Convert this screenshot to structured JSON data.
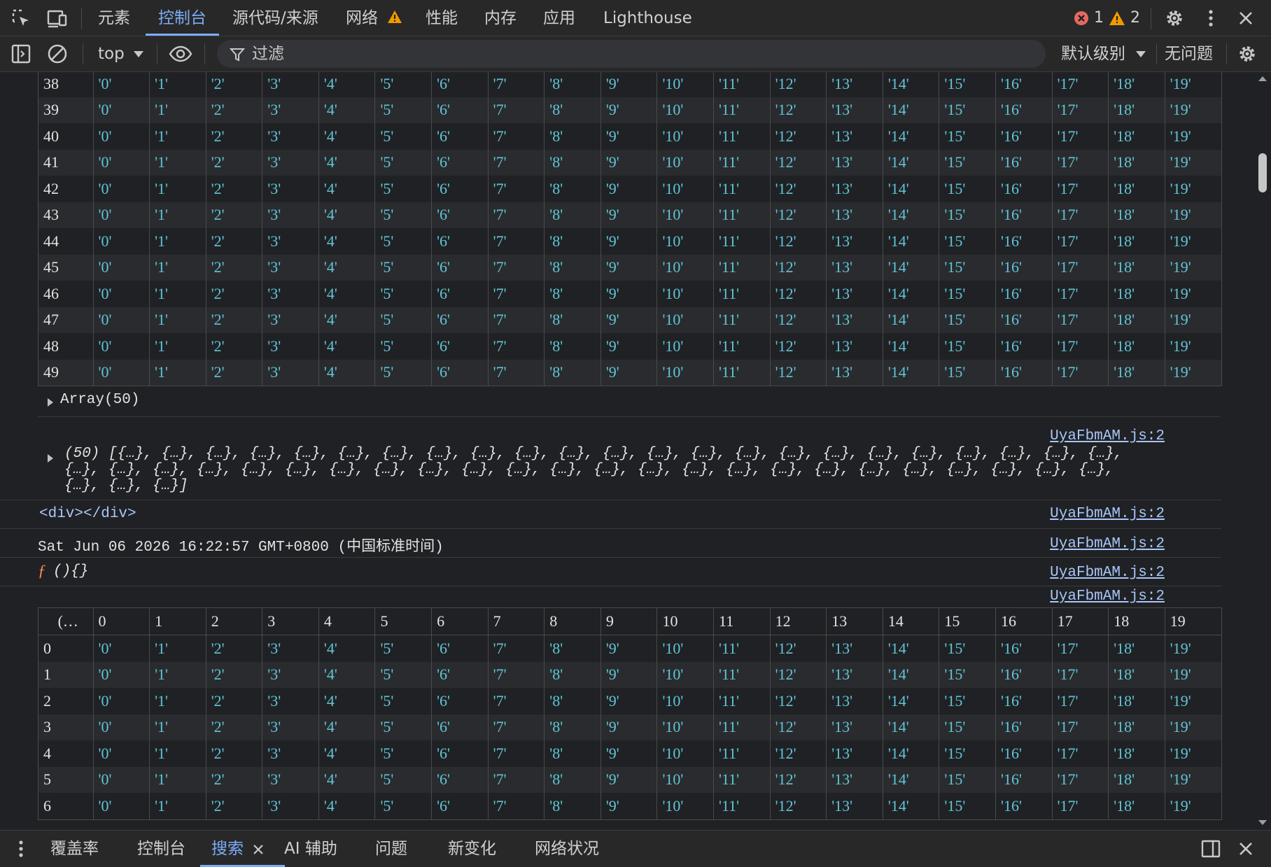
{
  "tabs": [
    {
      "label": "元素",
      "active": false
    },
    {
      "label": "控制台",
      "active": true
    },
    {
      "label": "源代码/来源",
      "active": false
    },
    {
      "label": "网络",
      "active": false,
      "warning": true
    },
    {
      "label": "性能",
      "active": false
    },
    {
      "label": "内存",
      "active": false
    },
    {
      "label": "应用",
      "active": false
    },
    {
      "label": "Lighthouse",
      "active": false
    }
  ],
  "counts": {
    "errors": "1",
    "warnings": "2"
  },
  "toolbar": {
    "context": "top",
    "filter_placeholder": "过滤",
    "levels": "默认级别",
    "issues": "无问题"
  },
  "table1": {
    "rows": [
      "38",
      "39",
      "40",
      "41",
      "42",
      "43",
      "44",
      "45",
      "46",
      "47",
      "48",
      "49"
    ],
    "values": [
      "'0'",
      "'1'",
      "'2'",
      "'3'",
      "'4'",
      "'5'",
      "'6'",
      "'7'",
      "'8'",
      "'9'",
      "'10'",
      "'11'",
      "'12'",
      "'13'",
      "'14'",
      "'15'",
      "'16'",
      "'17'",
      "'18'",
      "'19'"
    ]
  },
  "messages": {
    "array_label": "Array(50)",
    "array_source": "UyaFbmAM.js:2",
    "array_preview_line1": "(50)  [{…}, {…}, {…}, {…}, {…}, {…}, {…}, {…}, {…}, {…}, {…}, {…}, {…}, {…}, {…}, {…}, {…}, {…}, {…}, {…}, {…}, {…}, {…},",
    "array_preview_line2": "{…}, {…}, {…}, {…}, {…}, {…}, {…}, {…}, {…}, {…}, {…}, {…}, {…}, {…}, {…}, {…}, {…}, {…}, {…}, {…}, {…}, {…}, {…}, {…},",
    "array_preview_line3": "{…}, {…}, {…}]",
    "div_text": "<div></div>",
    "div_source": "UyaFbmAM.js:2",
    "date_text": "Sat Jun 06 2026 16:22:57 GMT+0800 (中国标准时间)",
    "date_source": "UyaFbmAM.js:2",
    "func_f": "ƒ",
    "func_text": " (){}",
    "func_source": "UyaFbmAM.js:2",
    "table2_source": "UyaFbmAM.js:2"
  },
  "table2": {
    "index_header": "(…",
    "headers": [
      "0",
      "1",
      "2",
      "3",
      "4",
      "5",
      "6",
      "7",
      "8",
      "9",
      "10",
      "11",
      "12",
      "13",
      "14",
      "15",
      "16",
      "17",
      "18",
      "19"
    ],
    "rows": [
      "0",
      "1",
      "2",
      "3",
      "4",
      "5",
      "6"
    ],
    "values": [
      "'0'",
      "'1'",
      "'2'",
      "'3'",
      "'4'",
      "'5'",
      "'6'",
      "'7'",
      "'8'",
      "'9'",
      "'10'",
      "'11'",
      "'12'",
      "'13'",
      "'14'",
      "'15'",
      "'16'",
      "'17'",
      "'18'",
      "'19'"
    ]
  },
  "drawer": {
    "tabs": [
      {
        "label": "覆盖率",
        "active": false
      },
      {
        "label": "控制台",
        "active": false
      },
      {
        "label": "搜索",
        "active": true,
        "closable": true
      },
      {
        "label": "AI 辅助",
        "active": false
      },
      {
        "label": "问题",
        "active": false
      },
      {
        "label": "新变化",
        "active": false
      },
      {
        "label": "网络状况",
        "active": false
      }
    ]
  },
  "colors": {
    "accent": "#7cacf8",
    "value": "#5fc6d8",
    "error": "#e46962",
    "warning": "#f29900",
    "link": "#a8c7fa"
  }
}
